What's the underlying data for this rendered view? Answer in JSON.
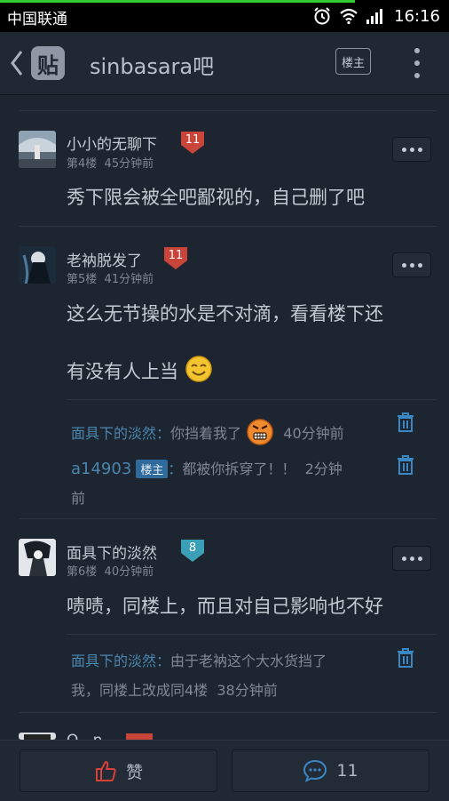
{
  "status_bar": {
    "carrier": "中国联通",
    "time": "16:16"
  },
  "header": {
    "logo_char": "贴",
    "title": "sinbasara吧",
    "louzhu_label": "楼主"
  },
  "posts": [
    {
      "username": "小小的无聊下",
      "level": "11",
      "floor": "第4楼",
      "time": "45分钟前",
      "text": "秀下限会被全吧鄙视的，自己删了吧",
      "badge_color": "#c9453a"
    },
    {
      "username": "老衲脱发了",
      "level": "11",
      "floor": "第5楼",
      "time": "41分钟前",
      "text_line1": "这么无节操的水是不对滴，看看楼下还",
      "text_line2": "有没有人上当",
      "badge_color": "#c9453a",
      "replies": [
        {
          "name": "面具下的淡然",
          "sep": "：",
          "text": "你挡着我了",
          "time": "40分钟前"
        },
        {
          "name": "a14903",
          "tag": "楼主",
          "sep": "：",
          "text": "都被你拆穿了！！",
          "time_a": "2分钟",
          "time_b": "前"
        }
      ]
    },
    {
      "username": "面具下的淡然",
      "level": "8",
      "floor": "第6楼",
      "time": "40分钟前",
      "text": "啧啧，同楼上，而且对自己影响也不好",
      "badge_color": "#3aa0b8",
      "replies": [
        {
          "name": "面具下的淡然",
          "sep": "：",
          "text_a": "由于老衲这个大水货挡了",
          "text_b": "我，同楼上改成同4楼",
          "time": "38分钟前"
        }
      ]
    }
  ],
  "partial_post": {
    "username_fragment": "Q...n"
  },
  "bottom_bar": {
    "like_label": "赞",
    "comment_count": "11"
  },
  "colors": {
    "background": "#1d2530",
    "link_blue": "#4a86b0",
    "level_red": "#c9453a",
    "level_teal": "#3aa0b8"
  }
}
